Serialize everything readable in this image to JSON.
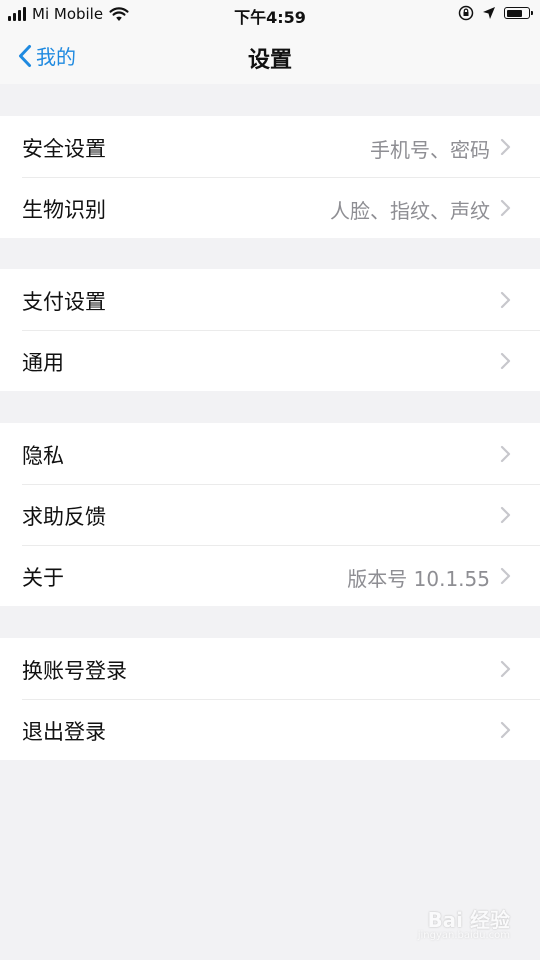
{
  "status_bar": {
    "carrier": "Mi Mobile",
    "time": "下午4:59",
    "battery_level": 0.75
  },
  "nav": {
    "back_label": "我的",
    "title": "设置"
  },
  "groups": [
    {
      "items": [
        {
          "label": "安全设置",
          "value": "手机号、密码"
        },
        {
          "label": "生物识别",
          "value": "人脸、指纹、声纹"
        }
      ]
    },
    {
      "items": [
        {
          "label": "支付设置",
          "value": ""
        },
        {
          "label": "通用",
          "value": ""
        }
      ]
    },
    {
      "items": [
        {
          "label": "隐私",
          "value": ""
        },
        {
          "label": "求助反馈",
          "value": ""
        },
        {
          "label": "关于",
          "value": "版本号 10.1.55"
        }
      ]
    },
    {
      "items": [
        {
          "label": "换账号登录",
          "value": ""
        },
        {
          "label": "退出登录",
          "value": ""
        }
      ]
    }
  ],
  "watermark": {
    "brand": "Bai 经验",
    "domain": "jingyan.baidu.com"
  },
  "colors": {
    "accent": "#1f8ae0",
    "background": "#f2f2f4",
    "secondary_text": "#8e8e93"
  },
  "icons": {
    "back": "chevron-left-icon",
    "row": "chevron-right-icon",
    "wifi": "wifi-icon",
    "signal": "cell-signal-icon",
    "lock": "orientation-lock-icon",
    "location": "location-arrow-icon",
    "battery": "battery-icon"
  }
}
